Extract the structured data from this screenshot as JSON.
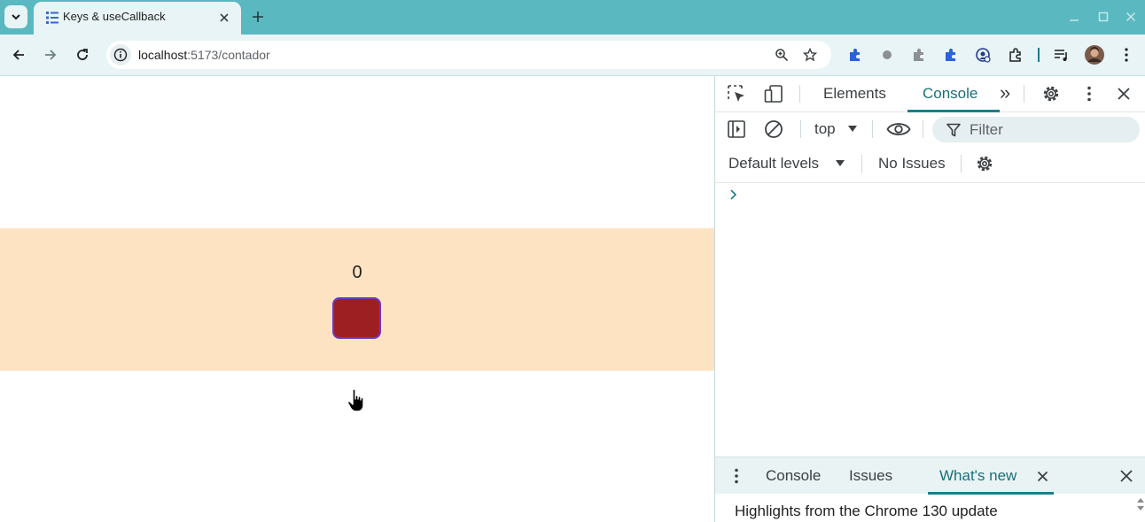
{
  "browser": {
    "tab": {
      "title": "Keys & useCallback"
    },
    "address": {
      "host": "localhost",
      "path": ":5173/contador"
    },
    "icons": {
      "tab_menu": "chevron-down-icon",
      "new_tab": "plus-icon",
      "back": "arrow-left-icon",
      "forward": "arrow-right-icon",
      "reload": "reload-icon",
      "site_info": "info-icon",
      "zoom": "zoom-icon",
      "bookmark": "star-icon",
      "extensions": [
        "puzzle-icon",
        "dot-icon",
        "puzzle-icon",
        "puzzle-icon",
        "password-manager-icon",
        "extensions-icon"
      ],
      "media": "media-control-icon",
      "profile": "avatar",
      "menu": "kebab-icon"
    }
  },
  "page": {
    "counter": {
      "value": "0"
    },
    "colors": {
      "section_background": "#fde3c2",
      "button_fill": "#9e1f22",
      "button_border": "#6a39c6"
    }
  },
  "devtools": {
    "tabs": {
      "elements": "Elements",
      "console": "Console",
      "more": "»"
    },
    "toolbar": {
      "context": "top",
      "filter_placeholder": "Filter",
      "levels": "Default levels",
      "issues": "No Issues"
    },
    "drawer": {
      "tabs": {
        "console": "Console",
        "issues": "Issues",
        "whats_new": "What's new"
      },
      "highlights": "Highlights from the Chrome 130 update"
    },
    "colors": {
      "accent": "#1a7f8a"
    }
  }
}
